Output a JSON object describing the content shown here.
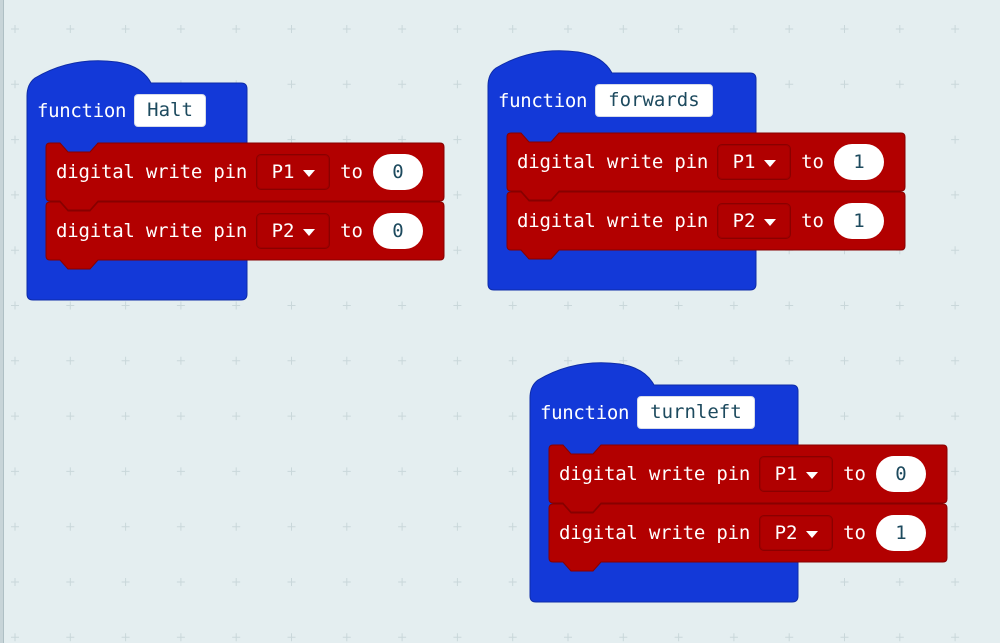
{
  "workspace": {
    "background": "#e4eef0",
    "grid_color": "#c9d7da"
  },
  "colors": {
    "function_block": "#1339d8",
    "function_block_dark": "#0e2ca8",
    "pins_block": "#b20000",
    "pins_block_dark": "#870000",
    "field_text": "#1d4a5e"
  },
  "icons": {
    "dropdown": "caret-down-icon"
  },
  "functions": [
    {
      "keyword": "function",
      "name": "Halt",
      "statements": [
        {
          "text": "digital write pin",
          "pin": "P1",
          "to_label": "to",
          "value": "0"
        },
        {
          "text": "digital write pin",
          "pin": "P2",
          "to_label": "to",
          "value": "0"
        }
      ]
    },
    {
      "keyword": "function",
      "name": "forwards",
      "statements": [
        {
          "text": "digital write pin",
          "pin": "P1",
          "to_label": "to",
          "value": "1"
        },
        {
          "text": "digital write pin",
          "pin": "P2",
          "to_label": "to",
          "value": "1"
        }
      ]
    },
    {
      "keyword": "function",
      "name": "turnleft",
      "statements": [
        {
          "text": "digital write pin",
          "pin": "P1",
          "to_label": "to",
          "value": "0"
        },
        {
          "text": "digital write pin",
          "pin": "P2",
          "to_label": "to",
          "value": "1"
        }
      ]
    }
  ]
}
